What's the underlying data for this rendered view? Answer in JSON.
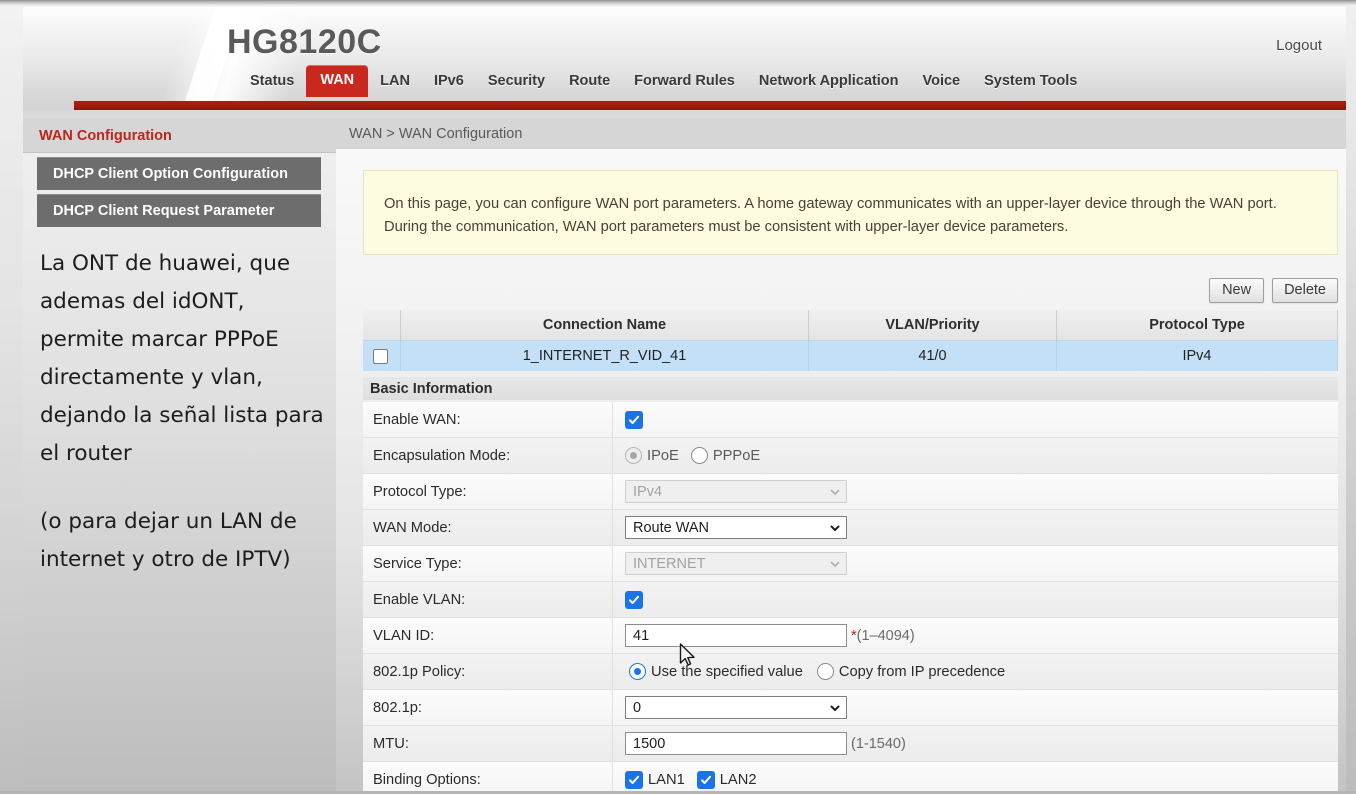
{
  "header": {
    "brand": "HG8120C",
    "logout": "Logout",
    "tabs": [
      {
        "label": "Status",
        "active": false
      },
      {
        "label": "WAN",
        "active": true
      },
      {
        "label": "LAN",
        "active": false
      },
      {
        "label": "IPv6",
        "active": false
      },
      {
        "label": "Security",
        "active": false
      },
      {
        "label": "Route",
        "active": false
      },
      {
        "label": "Forward Rules",
        "active": false
      },
      {
        "label": "Network Application",
        "active": false
      },
      {
        "label": "Voice",
        "active": false
      },
      {
        "label": "System Tools",
        "active": false
      }
    ],
    "accent_color": "#c8281d",
    "bar_color": "#9e1a10"
  },
  "sidebar": {
    "items": [
      {
        "label": "WAN Configuration",
        "style": "current"
      },
      {
        "label": "DHCP Client Option Configuration",
        "style": "dark"
      },
      {
        "label": "DHCP Client Request Parameter",
        "style": "dark"
      }
    ]
  },
  "annotation": {
    "paragraph1": "La ONT de huawei, que ademas del idONT, permite marcar PPPoE directamente y vlan, dejando la señal lista para el router",
    "paragraph2": "(o para dejar un LAN de internet y otro de IPTV)"
  },
  "breadcrumb": {
    "text": "WAN > WAN Configuration"
  },
  "info": {
    "text": "On this page, you can configure WAN port parameters. A home gateway communicates with an upper-layer device through the WAN port. During the communication, WAN port parameters must be consistent with upper-layer device parameters."
  },
  "toolbar": {
    "new_label": "New",
    "delete_label": "Delete"
  },
  "connection_table": {
    "headers": [
      "",
      "Connection Name",
      "VLAN/Priority",
      "Protocol Type"
    ],
    "rows": [
      {
        "selected": false,
        "connection_name": "1_INTERNET_R_VID_41",
        "vlan_priority": "41/0",
        "protocol_type": "IPv4"
      }
    ]
  },
  "basic_information": {
    "section_title": "Basic Information",
    "fields": {
      "enable_wan": {
        "label": "Enable WAN:",
        "checked": true
      },
      "encapsulation_mode": {
        "label": "Encapsulation Mode:",
        "options": [
          "IPoE",
          "PPPoE"
        ],
        "selected": "IPoE"
      },
      "protocol_type": {
        "label": "Protocol Type:",
        "value": "IPv4",
        "disabled": true
      },
      "wan_mode": {
        "label": "WAN Mode:",
        "value": "Route WAN",
        "disabled": false
      },
      "service_type": {
        "label": "Service Type:",
        "value": "INTERNET",
        "disabled": true
      },
      "enable_vlan": {
        "label": "Enable VLAN:",
        "checked": true
      },
      "vlan_id": {
        "label": "VLAN ID:",
        "value": "41",
        "required_mark": "*",
        "hint": "(1–4094)"
      },
      "p_policy": {
        "label": "802.1p Policy:",
        "options": [
          "Use the specified value",
          "Copy from IP precedence"
        ],
        "selected": "Use the specified value"
      },
      "p_value": {
        "label": "802.1p:",
        "value": "0",
        "disabled": false
      },
      "mtu": {
        "label": "MTU:",
        "value": "1500",
        "hint": "(1-1540)"
      },
      "binding_options": {
        "label": "Binding Options:",
        "items": [
          {
            "label": "LAN1",
            "checked": true
          },
          {
            "label": "LAN2",
            "checked": true
          }
        ]
      }
    }
  }
}
